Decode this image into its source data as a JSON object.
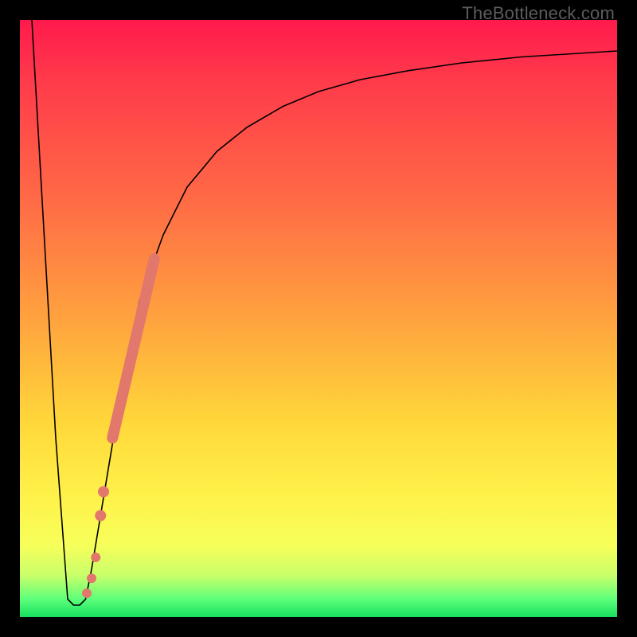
{
  "watermark": "TheBottleneck.com",
  "colors": {
    "curve": "#000000",
    "highlight": "#e2786c",
    "gradient_top": "#ff1a4d",
    "gradient_bottom": "#15e05f"
  },
  "chart_data": {
    "type": "line",
    "title": "",
    "xlabel": "",
    "ylabel": "",
    "xlim": [
      0,
      100
    ],
    "ylim": [
      0,
      100
    ],
    "grid": false,
    "legend": false,
    "series": [
      {
        "name": "bottleneck-curve",
        "x": [
          2,
          6,
          8,
          9,
          10,
          11,
          12,
          14,
          17,
          20,
          24,
          28,
          33,
          38,
          44,
          50,
          57,
          65,
          74,
          84,
          100
        ],
        "y": [
          100,
          30,
          3,
          2,
          2,
          3,
          8,
          20,
          38,
          53,
          64,
          72,
          78,
          82,
          85.5,
          88,
          90,
          91.5,
          92.8,
          93.8,
          94.8
        ]
      }
    ],
    "highlight_segment": {
      "name": "salmon-segment",
      "x": [
        15.5,
        22.5
      ],
      "y": [
        30,
        60
      ]
    },
    "highlight_points": [
      {
        "x": 13.5,
        "y": 17
      },
      {
        "x": 14.0,
        "y": 21
      },
      {
        "x": 12.7,
        "y": 10
      },
      {
        "x": 11.2,
        "y": 4
      },
      {
        "x": 12.0,
        "y": 6.5
      }
    ]
  }
}
